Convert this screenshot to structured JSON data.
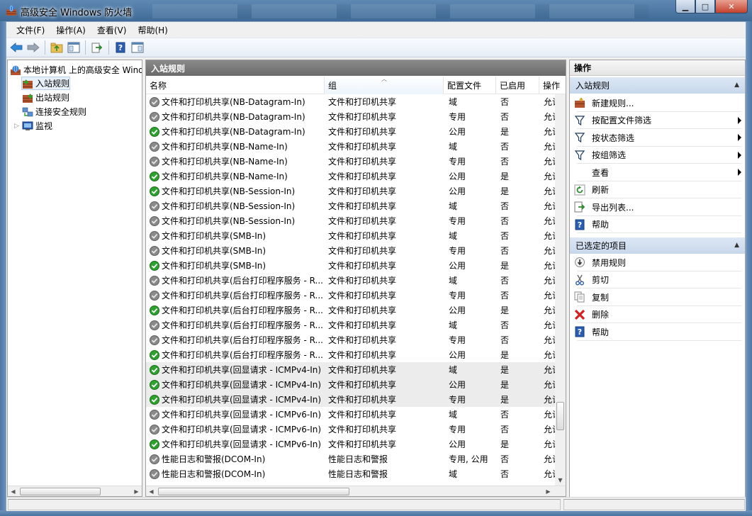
{
  "window": {
    "title": "高级安全 Windows 防火墙",
    "min_label": "▁",
    "max_label": "□",
    "close_label": "✕"
  },
  "menubar": {
    "items": [
      "文件(F)",
      "操作(A)",
      "查看(V)",
      "帮助(H)"
    ]
  },
  "tree": {
    "root": "本地计算机 上的高级安全 Windows 防火墙",
    "children": [
      "入站规则",
      "出站规则",
      "连接安全规则",
      "监视"
    ]
  },
  "middle": {
    "header": "入站规则",
    "columns": [
      "名称",
      "组",
      "配置文件",
      "已启用",
      "操作"
    ],
    "rows": [
      {
        "name": "文件和打印机共享(NB-Datagram-In)",
        "group": "文件和打印机共享",
        "profile": "域",
        "enabled": "否",
        "action": "允许",
        "state": "disabled",
        "hl": false
      },
      {
        "name": "文件和打印机共享(NB-Datagram-In)",
        "group": "文件和打印机共享",
        "profile": "专用",
        "enabled": "否",
        "action": "允许",
        "state": "disabled",
        "hl": false
      },
      {
        "name": "文件和打印机共享(NB-Datagram-In)",
        "group": "文件和打印机共享",
        "profile": "公用",
        "enabled": "是",
        "action": "允许",
        "state": "enabled",
        "hl": false
      },
      {
        "name": "文件和打印机共享(NB-Name-In)",
        "group": "文件和打印机共享",
        "profile": "域",
        "enabled": "否",
        "action": "允许",
        "state": "disabled",
        "hl": false
      },
      {
        "name": "文件和打印机共享(NB-Name-In)",
        "group": "文件和打印机共享",
        "profile": "专用",
        "enabled": "否",
        "action": "允许",
        "state": "disabled",
        "hl": false
      },
      {
        "name": "文件和打印机共享(NB-Name-In)",
        "group": "文件和打印机共享",
        "profile": "公用",
        "enabled": "是",
        "action": "允许",
        "state": "enabled",
        "hl": false
      },
      {
        "name": "文件和打印机共享(NB-Session-In)",
        "group": "文件和打印机共享",
        "profile": "公用",
        "enabled": "是",
        "action": "允许",
        "state": "enabled",
        "hl": false
      },
      {
        "name": "文件和打印机共享(NB-Session-In)",
        "group": "文件和打印机共享",
        "profile": "域",
        "enabled": "否",
        "action": "允许",
        "state": "disabled",
        "hl": false
      },
      {
        "name": "文件和打印机共享(NB-Session-In)",
        "group": "文件和打印机共享",
        "profile": "专用",
        "enabled": "否",
        "action": "允许",
        "state": "disabled",
        "hl": false
      },
      {
        "name": "文件和打印机共享(SMB-In)",
        "group": "文件和打印机共享",
        "profile": "域",
        "enabled": "否",
        "action": "允许",
        "state": "disabled",
        "hl": false
      },
      {
        "name": "文件和打印机共享(SMB-In)",
        "group": "文件和打印机共享",
        "profile": "专用",
        "enabled": "否",
        "action": "允许",
        "state": "disabled",
        "hl": false
      },
      {
        "name": "文件和打印机共享(SMB-In)",
        "group": "文件和打印机共享",
        "profile": "公用",
        "enabled": "是",
        "action": "允许",
        "state": "enabled",
        "hl": false
      },
      {
        "name": "文件和打印机共享(后台打印程序服务 - R...",
        "group": "文件和打印机共享",
        "profile": "域",
        "enabled": "否",
        "action": "允许",
        "state": "disabled",
        "hl": false
      },
      {
        "name": "文件和打印机共享(后台打印程序服务 - R...",
        "group": "文件和打印机共享",
        "profile": "专用",
        "enabled": "否",
        "action": "允许",
        "state": "disabled",
        "hl": false
      },
      {
        "name": "文件和打印机共享(后台打印程序服务 - R...",
        "group": "文件和打印机共享",
        "profile": "公用",
        "enabled": "是",
        "action": "允许",
        "state": "enabled",
        "hl": false
      },
      {
        "name": "文件和打印机共享(后台打印程序服务 - R...",
        "group": "文件和打印机共享",
        "profile": "域",
        "enabled": "否",
        "action": "允许",
        "state": "disabled",
        "hl": false
      },
      {
        "name": "文件和打印机共享(后台打印程序服务 - R...",
        "group": "文件和打印机共享",
        "profile": "专用",
        "enabled": "否",
        "action": "允许",
        "state": "disabled",
        "hl": false
      },
      {
        "name": "文件和打印机共享(后台打印程序服务 - R...",
        "group": "文件和打印机共享",
        "profile": "公用",
        "enabled": "是",
        "action": "允许",
        "state": "enabled",
        "hl": false
      },
      {
        "name": "文件和打印机共享(回显请求 - ICMPv4-In)",
        "group": "文件和打印机共享",
        "profile": "域",
        "enabled": "是",
        "action": "允许",
        "state": "enabled",
        "hl": true
      },
      {
        "name": "文件和打印机共享(回显请求 - ICMPv4-In)",
        "group": "文件和打印机共享",
        "profile": "公用",
        "enabled": "是",
        "action": "允许",
        "state": "enabled",
        "hl": true
      },
      {
        "name": "文件和打印机共享(回显请求 - ICMPv4-In)",
        "group": "文件和打印机共享",
        "profile": "专用",
        "enabled": "是",
        "action": "允许",
        "state": "enabled",
        "hl": true
      },
      {
        "name": "文件和打印机共享(回显请求 - ICMPv6-In)",
        "group": "文件和打印机共享",
        "profile": "域",
        "enabled": "否",
        "action": "允许",
        "state": "disabled",
        "hl": false
      },
      {
        "name": "文件和打印机共享(回显请求 - ICMPv6-In)",
        "group": "文件和打印机共享",
        "profile": "专用",
        "enabled": "否",
        "action": "允许",
        "state": "disabled",
        "hl": false
      },
      {
        "name": "文件和打印机共享(回显请求 - ICMPv6-In)",
        "group": "文件和打印机共享",
        "profile": "公用",
        "enabled": "是",
        "action": "允许",
        "state": "enabled",
        "hl": false
      },
      {
        "name": "性能日志和警报(DCOM-In)",
        "group": "性能日志和警报",
        "profile": "专用, 公用",
        "enabled": "否",
        "action": "允许",
        "state": "disabled",
        "hl": false
      },
      {
        "name": "性能日志和警报(DCOM-In)",
        "group": "性能日志和警报",
        "profile": "域",
        "enabled": "否",
        "action": "允许",
        "state": "disabled",
        "hl": false
      }
    ]
  },
  "actions": {
    "title": "操作",
    "section1": {
      "label": "入站规则",
      "items": [
        {
          "label": "新建规则...",
          "icon": "new-rule-icon",
          "submenu": false
        },
        {
          "label": "按配置文件筛选",
          "icon": "filter-icon",
          "submenu": true
        },
        {
          "label": "按状态筛选",
          "icon": "filter-icon",
          "submenu": true
        },
        {
          "label": "按组筛选",
          "icon": "filter-icon",
          "submenu": true
        },
        {
          "label": "查看",
          "icon": "",
          "submenu": true
        },
        {
          "label": "刷新",
          "icon": "refresh-icon",
          "submenu": false
        },
        {
          "label": "导出列表...",
          "icon": "export-icon",
          "submenu": false
        },
        {
          "label": "帮助",
          "icon": "help-icon",
          "submenu": false
        }
      ]
    },
    "section2": {
      "label": "已选定的项目",
      "items": [
        {
          "label": "禁用规则",
          "icon": "disable-icon"
        },
        {
          "label": "剪切",
          "icon": "cut-icon"
        },
        {
          "label": "复制",
          "icon": "copy-icon"
        },
        {
          "label": "删除",
          "icon": "delete-icon"
        },
        {
          "label": "帮助",
          "icon": "help-icon"
        }
      ]
    }
  },
  "colors": {
    "enabled_green": "#2ea12e",
    "disabled_gray": "#8a8a8a",
    "section_blue": "#c7d7eb"
  }
}
